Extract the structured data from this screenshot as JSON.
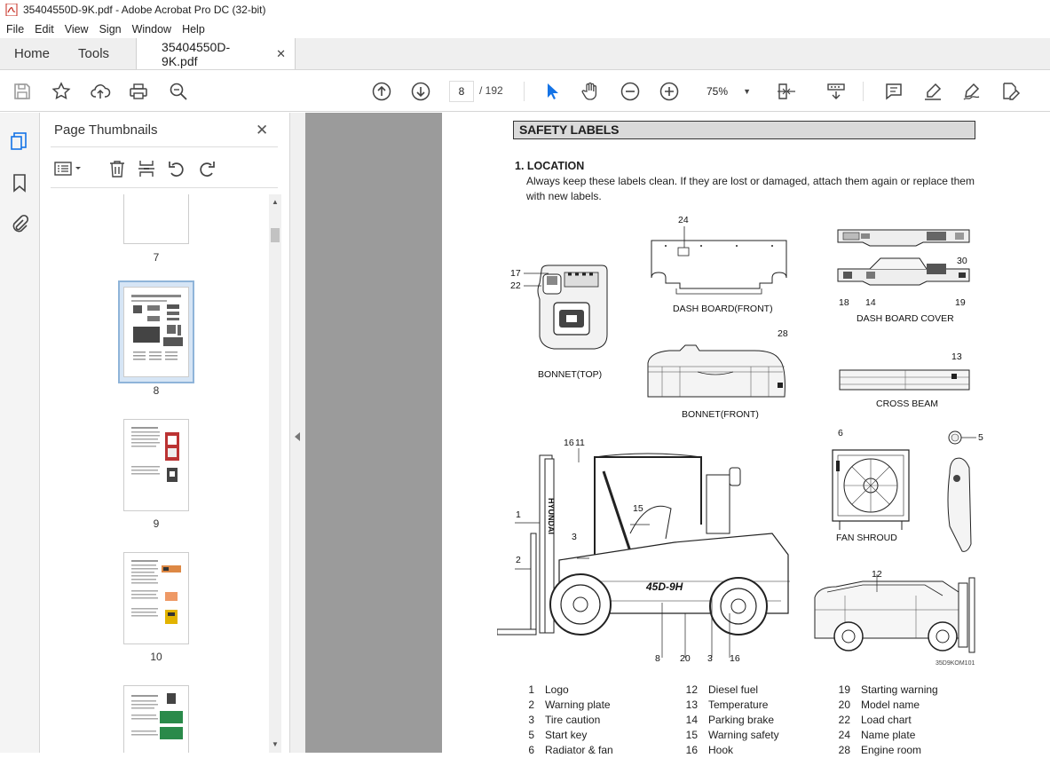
{
  "window": {
    "title": "35404550D-9K.pdf - Adobe Acrobat Pro DC (32-bit)"
  },
  "menu": [
    "File",
    "Edit",
    "View",
    "Sign",
    "Window",
    "Help"
  ],
  "tabs": {
    "home": "Home",
    "tools": "Tools",
    "document": "35404550D-9K.pdf"
  },
  "toolbar": {
    "current_page": "8",
    "total_pages": "/ 192",
    "zoom": "75%"
  },
  "thumbnails": {
    "title": "Page Thumbnails",
    "pages": [
      "7",
      "8",
      "9",
      "10"
    ],
    "selected_page": "8"
  },
  "document": {
    "heading": "SAFETY LABELS",
    "section": "1. LOCATION",
    "paragraph": "Always keep these labels clean.  If they are lost or damaged, attach them again or replace them with new labels.",
    "figure_labels": {
      "bonnet_top": "BONNET(TOP)",
      "dash_board_front": "DASH BOARD(FRONT)",
      "dash_board_cover": "DASH BOARD COVER",
      "bonnet_front": "BONNET(FRONT)",
      "cross_beam": "CROSS BEAM",
      "fan_shroud": "FAN SHROUD",
      "figure_code": "35D9KOM101",
      "model": "45D-9H",
      "brand": "HYUNDAI"
    },
    "callouts": [
      "24",
      "17",
      "22",
      "30",
      "18",
      "14",
      "19",
      "28",
      "13",
      "16",
      "11",
      "6",
      "5",
      "1",
      "15",
      "3",
      "2",
      "12",
      "8",
      "20",
      "3",
      "16"
    ],
    "legend": [
      [
        {
          "n": "1",
          "t": "Logo"
        },
        {
          "n": "2",
          "t": "Warning plate"
        },
        {
          "n": "3",
          "t": "Tire caution"
        },
        {
          "n": "5",
          "t": "Start key"
        },
        {
          "n": "6",
          "t": "Radiator & fan"
        }
      ],
      [
        {
          "n": "12",
          "t": "Diesel fuel"
        },
        {
          "n": "13",
          "t": "Temperature"
        },
        {
          "n": "14",
          "t": "Parking brake"
        },
        {
          "n": "15",
          "t": "Warning safety"
        },
        {
          "n": "16",
          "t": "Hook"
        }
      ],
      [
        {
          "n": "19",
          "t": "Starting warning"
        },
        {
          "n": "20",
          "t": "Model name"
        },
        {
          "n": "22",
          "t": "Load chart"
        },
        {
          "n": "24",
          "t": "Name plate"
        },
        {
          "n": "28",
          "t": "Engine room"
        }
      ]
    ]
  }
}
